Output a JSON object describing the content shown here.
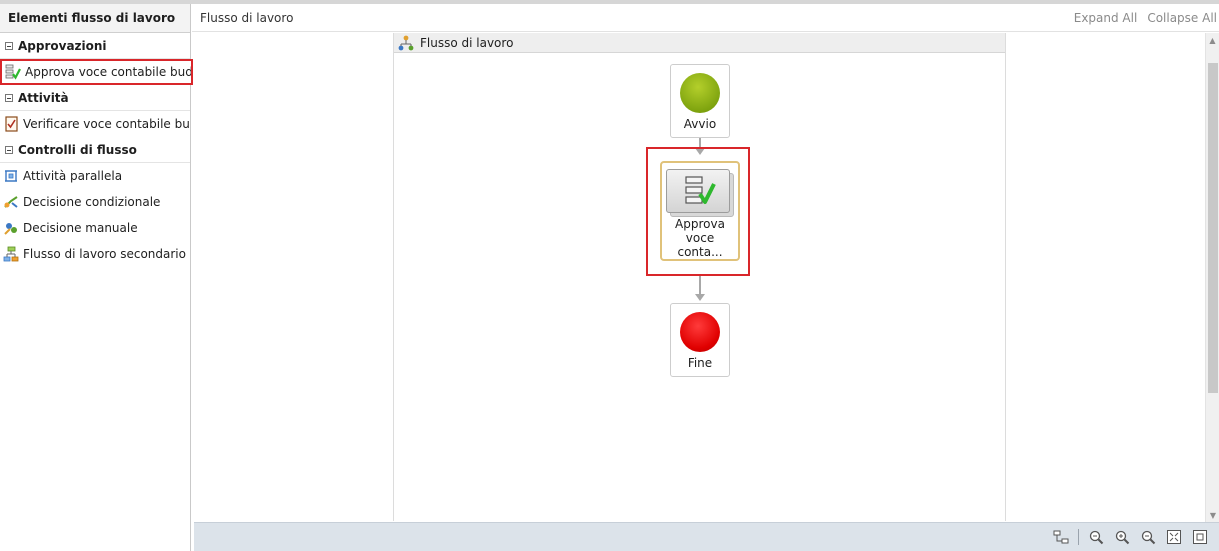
{
  "left_panel": {
    "title": "Elementi flusso di lavoro",
    "groups": [
      {
        "label": "Approvazioni",
        "items": [
          {
            "label": "Approva voce contabile budget",
            "icon": "approval-task-icon",
            "selected": true
          }
        ]
      },
      {
        "label": "Attività",
        "items": [
          {
            "label": "Verificare voce contabile budge",
            "icon": "checklist-icon"
          }
        ]
      },
      {
        "label": "Controlli di flusso",
        "items": [
          {
            "label": "Attività parallela",
            "icon": "parallel-activity-icon"
          },
          {
            "label": "Decisione condizionale",
            "icon": "conditional-decision-icon"
          },
          {
            "label": "Decisione manuale",
            "icon": "manual-decision-icon"
          },
          {
            "label": "Flusso di lavoro secondario",
            "icon": "subworkflow-icon"
          }
        ]
      }
    ]
  },
  "main": {
    "breadcrumb": "Flusso di lavoro",
    "expand_all": "Expand All",
    "collapse_all": "Collapse All",
    "flow_title": "Flusso di lavoro",
    "nodes": {
      "start": "Avvio",
      "task_line1": "Approva",
      "task_line2": "voce conta...",
      "end": "Fine"
    }
  },
  "colors": {
    "selection": "#d9262a",
    "task_border": "#e0c27a",
    "start": "#8db01a",
    "end": "#e00000"
  }
}
